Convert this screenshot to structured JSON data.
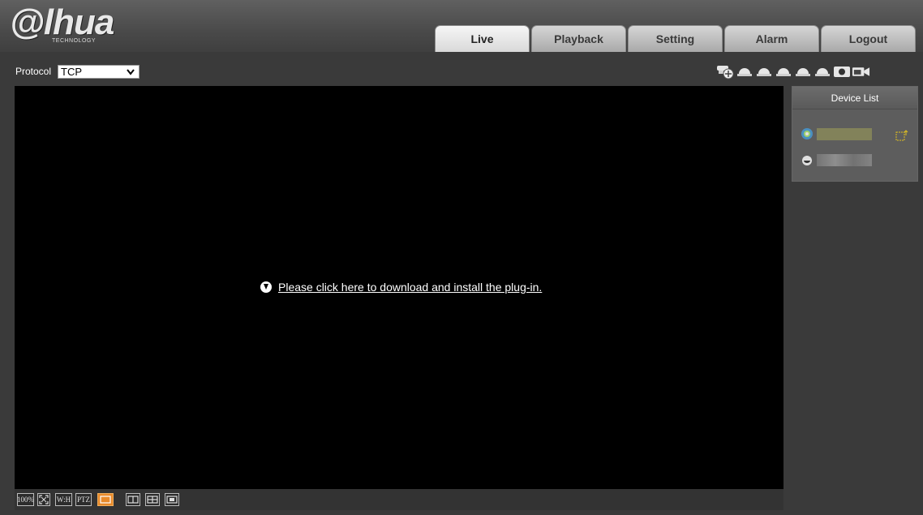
{
  "logo": {
    "main": "@lhua",
    "sub": "TECHNOLOGY"
  },
  "tabs": [
    {
      "label": "Live",
      "active": true
    },
    {
      "label": "Playback",
      "active": false
    },
    {
      "label": "Setting",
      "active": false
    },
    {
      "label": "Alarm",
      "active": false
    },
    {
      "label": "Logout",
      "active": false
    }
  ],
  "toolbar": {
    "protocol_label": "Protocol",
    "protocol_value": "TCP",
    "camera_icons": [
      "ptz-camera-icon",
      "dome-camera-icon",
      "dome-camera-icon",
      "dome-camera-icon",
      "dome-camera-icon",
      "dome-camera-icon",
      "snapshot-icon",
      "record-icon"
    ]
  },
  "video": {
    "plugin_message": "Please click here to download and install the plug-in."
  },
  "video_bar": {
    "buttons": [
      {
        "name": "zoom-100",
        "label": "100%"
      },
      {
        "name": "fullscreen",
        "label": ""
      },
      {
        "name": "aspect-ratio",
        "label": "W:H"
      },
      {
        "name": "ptz",
        "label": "PTZ"
      },
      {
        "name": "layout-1",
        "label": "",
        "active": true
      },
      {
        "name": "layout-2",
        "label": ""
      },
      {
        "name": "layout-4",
        "label": ""
      },
      {
        "name": "layout-pip",
        "label": ""
      }
    ]
  },
  "device_list": {
    "title": "Device List"
  },
  "colors": {
    "background": "#3a3a3a",
    "video_bg": "#000000",
    "accent": "#e88a2a"
  }
}
